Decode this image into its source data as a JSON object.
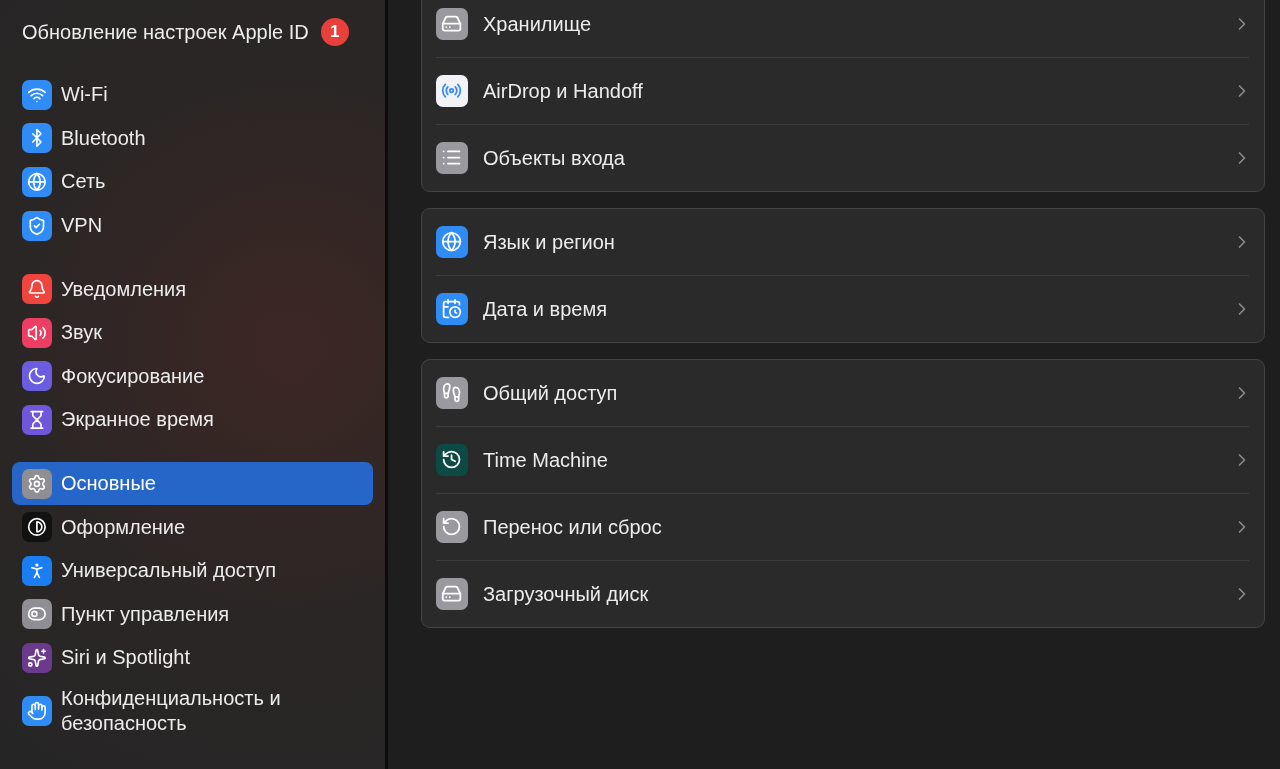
{
  "sidebar": {
    "account": {
      "label": "Обновление настроек Apple ID",
      "badge": "1"
    },
    "groups": [
      {
        "items": [
          {
            "label": "Wi-Fi",
            "color": "#2f8cf6",
            "selected": false
          },
          {
            "label": "Bluetooth",
            "color": "#2f8cf6",
            "selected": false
          },
          {
            "label": "Сеть",
            "color": "#2f8cf6",
            "selected": false
          },
          {
            "label": "VPN",
            "color": "#2f8cf6",
            "selected": false
          }
        ]
      },
      {
        "items": [
          {
            "label": "Уведомления",
            "color": "#f0453f",
            "selected": false
          },
          {
            "label": "Звук",
            "color": "#ec3d62",
            "selected": false
          },
          {
            "label": "Фокусирование",
            "color": "#6a5de0",
            "selected": false
          },
          {
            "label": "Экранное время",
            "color": "#6f56db",
            "selected": false
          }
        ]
      },
      {
        "items": [
          {
            "label": "Основные",
            "color": "#8e8e93",
            "selected": true
          },
          {
            "label": "Оформление",
            "color": "#111111",
            "selected": false
          },
          {
            "label": "Универсальный доступ",
            "color": "#1a7ef2",
            "selected": false
          },
          {
            "label": "Пункт управления",
            "color": "#8e8e93",
            "selected": false
          },
          {
            "label": "Siri и Spotlight",
            "color": "#6b3a8c",
            "selected": false
          },
          {
            "label": "Конфиденциальность и безопасность",
            "color": "#2f8cf6",
            "selected": false
          }
        ]
      }
    ]
  },
  "main": {
    "groups": [
      {
        "rows": [
          {
            "label": "Хранилище",
            "color": "#9a9a9e"
          },
          {
            "label": "AirDrop и Handoff",
            "color": "#f2f2f7"
          },
          {
            "label": "Объекты входа",
            "color": "#9a9a9e"
          }
        ]
      },
      {
        "rows": [
          {
            "label": "Язык и регион",
            "color": "#2f8cf6"
          },
          {
            "label": "Дата и время",
            "color": "#2f8cf6"
          }
        ]
      },
      {
        "rows": [
          {
            "label": "Общий доступ",
            "color": "#9a9a9e"
          },
          {
            "label": "Time Machine",
            "color": "#0e4a45"
          },
          {
            "label": "Перенос или сброс",
            "color": "#9a9a9e"
          },
          {
            "label": "Загрузочный диск",
            "color": "#9a9a9e"
          }
        ]
      }
    ]
  }
}
